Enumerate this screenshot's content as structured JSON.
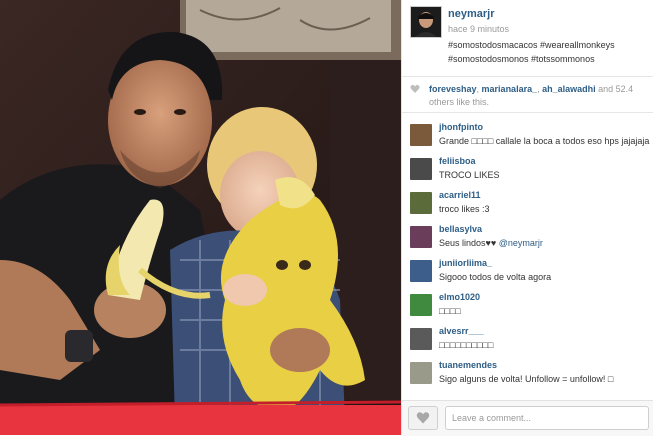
{
  "post": {
    "username": "neymarjr",
    "time_ago": "hace 9 minutos",
    "caption_lines": [
      "#somostodosmacacos #weareallmonkeys",
      "#somostodosmonos #totssommonos"
    ],
    "photo_description_icon": "photo"
  },
  "likes": {
    "heart_icon": "heart-icon",
    "users": [
      "foreveshay",
      "marianalara_",
      "ah_alawadhi"
    ],
    "suffix": " and 52.4",
    "suffix_line2": "others like this."
  },
  "comments": [
    {
      "user": "jhonfpinto",
      "text": "Grande □□□□ callale la boca a todos eso hps jajajaja",
      "avatar_color": "#7a5a3a"
    },
    {
      "user": "feliisboa",
      "text": "TROCO LIKES",
      "avatar_color": "#4a4a4a"
    },
    {
      "user": "acarriel11",
      "text": "troco likes :3",
      "avatar_color": "#5b6b3a"
    },
    {
      "user": "bellasylva",
      "text": "Seus lindos♥♥ ",
      "mention": "@neymarjr",
      "avatar_color": "#6a3d5a"
    },
    {
      "user": "juniiorliima_",
      "text": "Sigooo todos de volta agora",
      "avatar_color": "#3d5e8a"
    },
    {
      "user": "elmo1020",
      "text": "□□□□",
      "avatar_color": "#3f8a3f"
    },
    {
      "user": "alvesrr___",
      "text": "□□□□□□□□□□",
      "avatar_color": "#5a5a5a"
    },
    {
      "user": "tuanemendes",
      "text": "Sigo alguns de volta! Unfollow = unfollow! □",
      "avatar_color": "#9a9a8a"
    }
  ],
  "compose": {
    "placeholder": "Leave a comment..."
  },
  "colors": {
    "link_blue": "#2e5e86",
    "muted_gray": "#999999"
  }
}
